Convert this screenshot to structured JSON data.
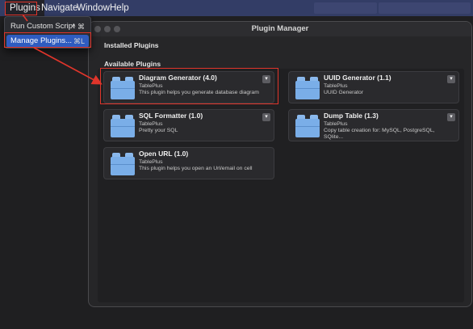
{
  "menubar": {
    "items": [
      "Plugins",
      "Navigate",
      "Window",
      "Help"
    ]
  },
  "dropdown": {
    "items": [
      {
        "label": "Run Custom Script",
        "shortcut": "^ ⌘"
      },
      {
        "label": "Manage Plugins...",
        "shortcut": "⌘L"
      }
    ]
  },
  "window": {
    "title": "Plugin Manager",
    "installed_title": "Installed Plugins",
    "available_title": "Available Plugins"
  },
  "plugins": [
    {
      "name": "Diagram Generator (4.0)",
      "author": "TablePlus",
      "desc1": "This plugin helps you generate database diagram",
      "desc2": ""
    },
    {
      "name": "UUID Generator (1.1)",
      "author": "TablePlus",
      "desc1": "UUID Generator",
      "desc2": ""
    },
    {
      "name": "SQL Formatter (1.0)",
      "author": "TablePlus",
      "desc1": "Pretty your SQL",
      "desc2": ""
    },
    {
      "name": "Dump Table (1.3)",
      "author": "TablePlus",
      "desc1": "Copy table creation for: MySQL, PostgreSQL,",
      "desc2": "SQlite..."
    },
    {
      "name": "Open URL (1.0)",
      "author": "TablePlus",
      "desc1": "This plugin helps you open an Url/email on cell",
      "desc2": ""
    }
  ],
  "icons": {
    "plugin": "plugin-block-icon",
    "chevron": "chevron-down-icon"
  },
  "colors": {
    "highlight": "#2f5cc0",
    "annotation": "#e0352b",
    "plugin_icon": "#7aaee8"
  }
}
